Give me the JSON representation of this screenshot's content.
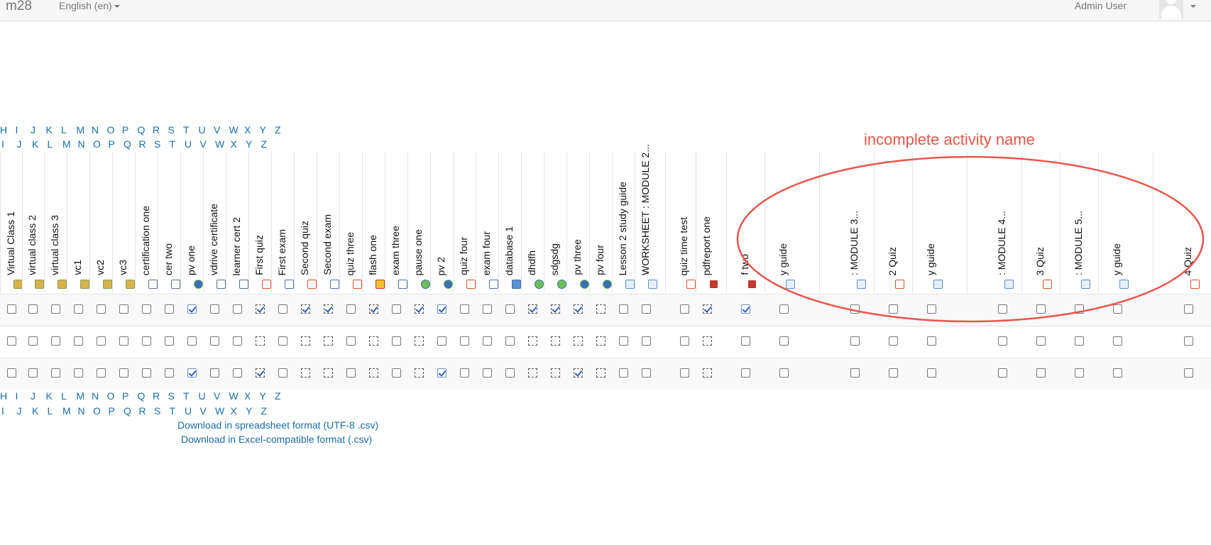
{
  "nav": {
    "brand": "m28",
    "language": "English (en)",
    "user": "Admin User"
  },
  "letters_row1": [
    "H",
    "I",
    "J",
    "K",
    "L",
    "M",
    "N",
    "O",
    "P",
    "Q",
    "R",
    "S",
    "T",
    "U",
    "V",
    "W",
    "X",
    "Y",
    "Z"
  ],
  "letters_row2": [
    "I",
    "J",
    "K",
    "L",
    "M",
    "N",
    "O",
    "P",
    "Q",
    "R",
    "S",
    "T",
    "U",
    "V",
    "W",
    "X",
    "Y",
    "Z"
  ],
  "downloads": {
    "csv": "Download in spreadsheet format (UTF-8 .csv)",
    "excel": "Download in Excel-compatible format (.csv)"
  },
  "annotation": "incomplete activity name",
  "columns": [
    {
      "label": "Virtual Class 1",
      "icon": "virtual-class-icon",
      "marks": [
        "n",
        "n",
        "n"
      ]
    },
    {
      "label": "virtual class 2",
      "icon": "virtual-class-icon",
      "marks": [
        "n",
        "n",
        "n"
      ]
    },
    {
      "label": "virtual class 3",
      "icon": "virtual-class-icon",
      "marks": [
        "n",
        "n",
        "n"
      ]
    },
    {
      "label": "vc1",
      "icon": "virtual-class-icon",
      "marks": [
        "n",
        "n",
        "n"
      ]
    },
    {
      "label": "vc2",
      "icon": "virtual-class-icon",
      "marks": [
        "n",
        "n",
        "n"
      ]
    },
    {
      "label": "vc3",
      "icon": "virtual-class-icon",
      "marks": [
        "n",
        "n",
        "n"
      ]
    },
    {
      "label": "certification one",
      "icon": "certificate-icon",
      "marks": [
        "n",
        "n",
        "n"
      ]
    },
    {
      "label": "cer two",
      "icon": "certificate-icon",
      "marks": [
        "n",
        "n",
        "n"
      ]
    },
    {
      "label": "pv one",
      "icon": "person-icon",
      "marks": [
        "y",
        "n",
        "y"
      ]
    },
    {
      "label": "vdrive certificate",
      "icon": "certificate-icon",
      "marks": [
        "n",
        "n",
        "n"
      ]
    },
    {
      "label": "learner cert 2",
      "icon": "certificate-icon",
      "marks": [
        "n",
        "n",
        "n"
      ]
    },
    {
      "label": "First quiz",
      "icon": "quiz-icon",
      "marks": [
        "dy",
        "d",
        "dy"
      ]
    },
    {
      "label": "First exam",
      "icon": "exam-icon",
      "marks": [
        "n",
        "n",
        "n"
      ]
    },
    {
      "label": "Second quiz",
      "icon": "quiz-icon",
      "marks": [
        "dy",
        "d",
        "d"
      ]
    },
    {
      "label": "Second exam",
      "icon": "exam-icon",
      "marks": [
        "dy",
        "d",
        "d"
      ]
    },
    {
      "label": "quiz three",
      "icon": "quiz-icon",
      "marks": [
        "n",
        "n",
        "n"
      ]
    },
    {
      "label": "flash one",
      "icon": "flash-icon",
      "marks": [
        "dy",
        "d",
        "d"
      ]
    },
    {
      "label": "exam three",
      "icon": "exam-icon",
      "marks": [
        "n",
        "n",
        "n"
      ]
    },
    {
      "label": "pause one",
      "icon": "target-icon",
      "marks": [
        "dy",
        "d",
        "d"
      ]
    },
    {
      "label": "pv 2",
      "icon": "person-icon",
      "marks": [
        "y",
        "n",
        "y"
      ]
    },
    {
      "label": "quiz four",
      "icon": "quiz-icon",
      "marks": [
        "n",
        "n",
        "n"
      ]
    },
    {
      "label": "exam four",
      "icon": "exam-icon",
      "marks": [
        "n",
        "n",
        "n"
      ]
    },
    {
      "label": "database 1",
      "icon": "database-icon",
      "marks": [
        "n",
        "n",
        "n"
      ]
    },
    {
      "label": "dhdfh",
      "icon": "target-icon",
      "marks": [
        "dy",
        "d",
        "d"
      ]
    },
    {
      "label": "sdgsdg",
      "icon": "target-icon",
      "marks": [
        "dy",
        "d",
        "d"
      ]
    },
    {
      "label": "pv three",
      "icon": "person-icon",
      "marks": [
        "dy",
        "d",
        "dy"
      ]
    },
    {
      "label": "pv four",
      "icon": "person-icon",
      "marks": [
        "d",
        "d",
        "d"
      ]
    },
    {
      "label": "Lesson 2 study guide",
      "icon": "page-icon",
      "marks": [
        "n",
        "n",
        "n"
      ]
    },
    {
      "label": "WORKSHEET : MODULE 2...",
      "icon": "worksheet-icon",
      "marks": [
        "n",
        "n",
        "n"
      ]
    },
    {
      "label": "quiz time test",
      "icon": "quiz-icon",
      "marks": [
        "n",
        "n",
        "n"
      ]
    },
    {
      "label": "pdfreport one",
      "icon": "pdf-icon",
      "marks": [
        "dy",
        "d",
        "d"
      ]
    },
    {
      "label": "f two",
      "icon": "pdf-icon",
      "marks": [
        "y",
        "n",
        "n"
      ]
    },
    {
      "label": "y guide",
      "icon": "page-icon",
      "marks": [
        "n",
        "n",
        "n"
      ]
    },
    {
      "label": ": MODULE 3...",
      "icon": "worksheet-icon",
      "marks": [
        "n",
        "n",
        "n"
      ]
    },
    {
      "label": "2 Quiz",
      "icon": "quiz-icon",
      "marks": [
        "n",
        "n",
        "n"
      ]
    },
    {
      "label": "y guide",
      "icon": "page-icon",
      "marks": [
        "n",
        "n",
        "n"
      ]
    },
    {
      "label": ": MODULE 4...",
      "icon": "worksheet-icon",
      "marks": [
        "n",
        "n",
        "n"
      ]
    },
    {
      "label": "3 Quiz",
      "icon": "quiz-icon",
      "marks": [
        "n",
        "n",
        "n"
      ]
    },
    {
      "label": ": MODULE 5...",
      "icon": "worksheet-icon",
      "marks": [
        "n",
        "n",
        "n"
      ]
    },
    {
      "label": "y guide",
      "icon": "page-icon",
      "marks": [
        "n",
        "n",
        "n"
      ]
    },
    {
      "label": "4 Quiz",
      "icon": "quiz-icon",
      "marks": [
        "n",
        "n",
        "n"
      ]
    }
  ]
}
